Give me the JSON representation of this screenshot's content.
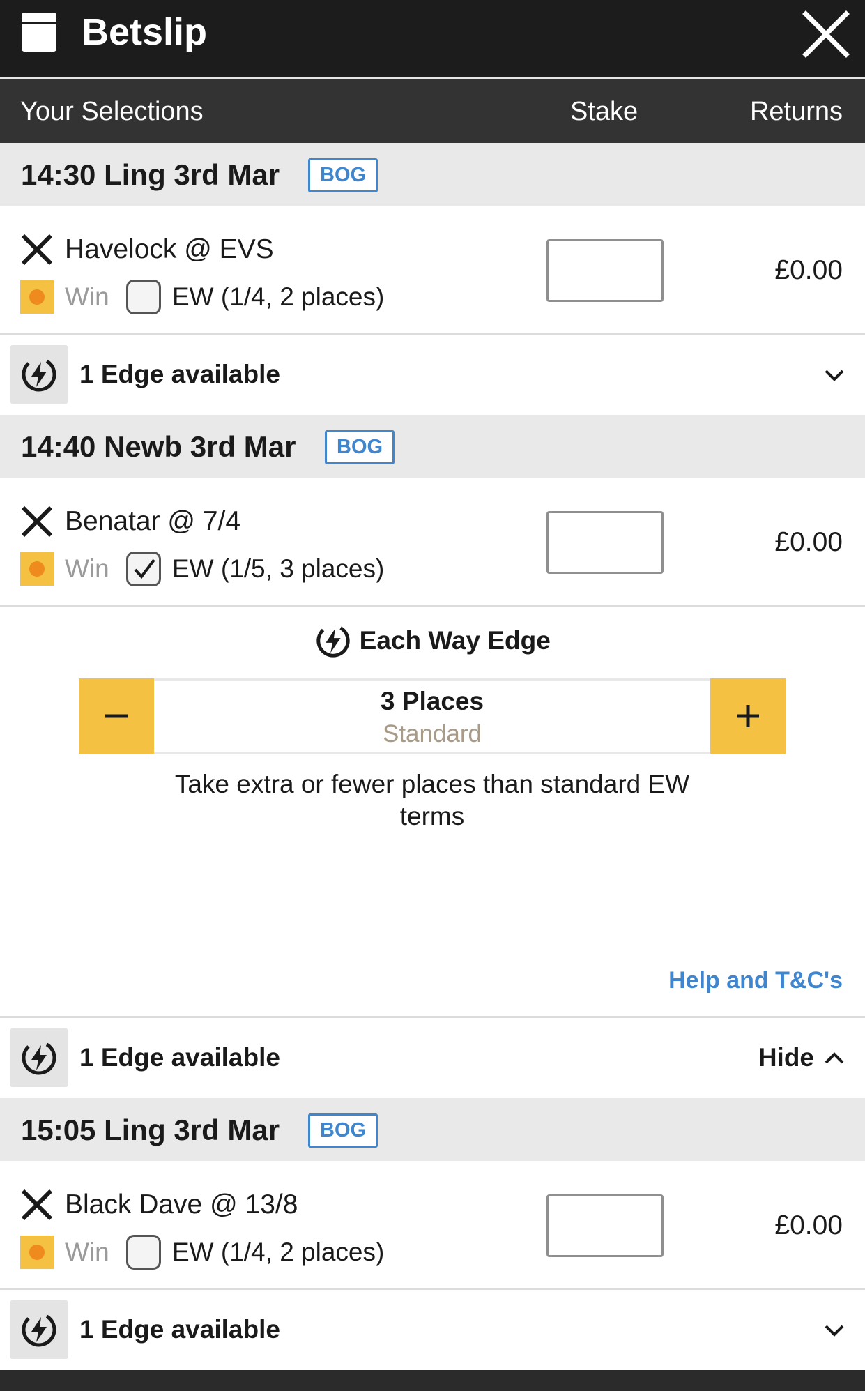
{
  "header": {
    "title": "Betslip",
    "betslip_icon": "betslip-icon",
    "close_icon": "close-icon"
  },
  "columns": {
    "selections": "Your Selections",
    "stake": "Stake",
    "returns": "Returns"
  },
  "races": [
    {
      "title": "14:30 Ling 3rd Mar",
      "badge": "BOG",
      "selection": {
        "name": "Havelock @ EVS",
        "win_label": "Win",
        "ew_label": "EW (1/4, 2 places)",
        "ew_checked": false,
        "stake_value": "",
        "returns": "£0.00"
      },
      "edge": {
        "label": "1 Edge available",
        "expanded": false
      }
    },
    {
      "title": "14:40 Newb 3rd Mar",
      "badge": "BOG",
      "selection": {
        "name": "Benatar @ 7/4",
        "win_label": "Win",
        "ew_label": "EW (1/5, 3 places)",
        "ew_checked": true,
        "stake_value": "",
        "returns": "£0.00"
      },
      "ew_edge": {
        "title": "Each Way Edge",
        "places": "3 Places",
        "places_sub": "Standard",
        "description": "Take extra or fewer places than standard EW terms",
        "help_link": "Help and T&C's"
      },
      "edge": {
        "label": "1 Edge available",
        "expanded": true,
        "toggle_label": "Hide"
      }
    },
    {
      "title": "15:05 Ling 3rd Mar",
      "badge": "BOG",
      "selection": {
        "name": "Black Dave @ 13/8",
        "win_label": "Win",
        "ew_label": "EW (1/4, 2 places)",
        "ew_checked": false,
        "stake_value": "",
        "returns": "£0.00"
      },
      "edge": {
        "label": "1 Edge available",
        "expanded": false
      }
    }
  ],
  "colors": {
    "header_bg": "#1c1c1c",
    "column_header_bg": "#333333",
    "race_header_bg": "#e9e9e9",
    "accent_yellow": "#f4c142",
    "win_dot": "#ef8a1f",
    "link_blue": "#3f86cf",
    "muted_tan": "#a89b87"
  }
}
